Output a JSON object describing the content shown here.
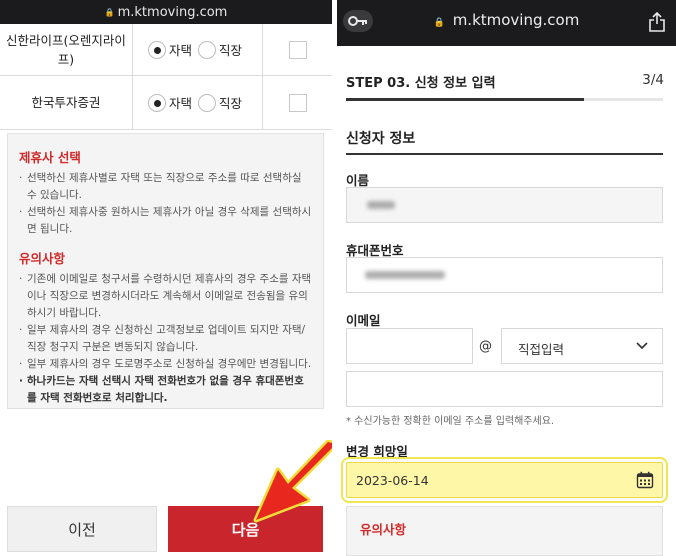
{
  "left": {
    "url": "m.ktmoving.com",
    "table_rows": [
      {
        "name": "신한라이프(오렌지라이프)",
        "opt_home": "자택",
        "opt_work": "직장",
        "selected": "home"
      },
      {
        "name": "한국투자증권",
        "opt_home": "자택",
        "opt_work": "직장",
        "selected": "home"
      }
    ],
    "notice": {
      "heading1": "제휴사 선택",
      "items1": [
        "선택하신 제휴사별로 자택 또는 직장으로 주소를 따로 선택하실 수 있습니다.",
        "선택하신 제휴사중 원하시는 제휴사가 아닐 경우 삭제를 선택하시면 됩니다."
      ],
      "heading2": "유의사항",
      "items2": [
        "기존에 이메일로 청구서를 수령하시던 제휴사의 경우 주소를 자택이나 직장으로 변경하시더라도 계속해서 이메일로 전송됨을 유의하시기 바랍니다.",
        "일부 제휴사의 경우 신청하신 고객정보로 업데이트 되지만 자택/직장 청구지 구분은 변동되지 않습니다.",
        "일부 제휴사의 경우 도로명주소로 신청하실 경우에만 변경됩니다.",
        "하나카드는 자택 선택시 자택 전화번호가 없을 경우 휴대폰번호를 자택 전화번호로 처리합니다."
      ]
    },
    "buttons": {
      "prev": "이전",
      "next": "다음"
    },
    "colors": {
      "accent": "#c8252c",
      "arrow": "#e8281e"
    }
  },
  "right": {
    "url": "m.ktmoving.com",
    "step_title": "STEP 03. 신청 정보 입력",
    "step_count": "3/4",
    "progress": 0.75,
    "section_title": "신청자 정보",
    "labels": {
      "name": "이름",
      "phone": "휴대폰번호",
      "email": "이메일",
      "date": "변경 희망일"
    },
    "email_at": "@",
    "email_domain_select": "직접입력",
    "hint": "* 수신가능한 정확한 이메일 주소를 입력해주세요.",
    "date_value": "2023-06-14",
    "notice_heading": "유의사항",
    "colors": {
      "highlight": "#fff7a8",
      "notice_red": "#d02a2a"
    }
  }
}
